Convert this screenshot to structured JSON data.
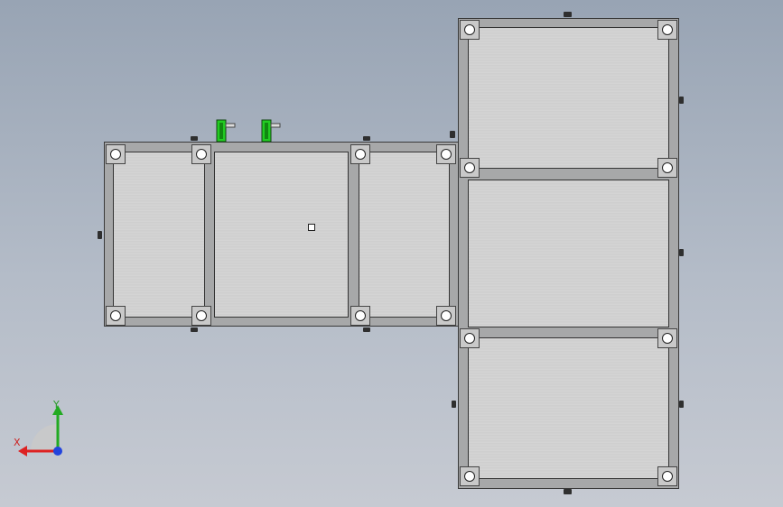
{
  "viewport": {
    "background_top": "#98a4b4",
    "background_bottom": "#c6cad2"
  },
  "triad": {
    "x_label": "X",
    "y_label": "Y",
    "x_color": "#dd2222",
    "y_color": "#22aa22",
    "z_color": "#2244dd"
  },
  "part": {
    "frame_color": "#a7a8a9",
    "plate_color": "#d4d4d4",
    "clamp_color": "#22cc22"
  }
}
